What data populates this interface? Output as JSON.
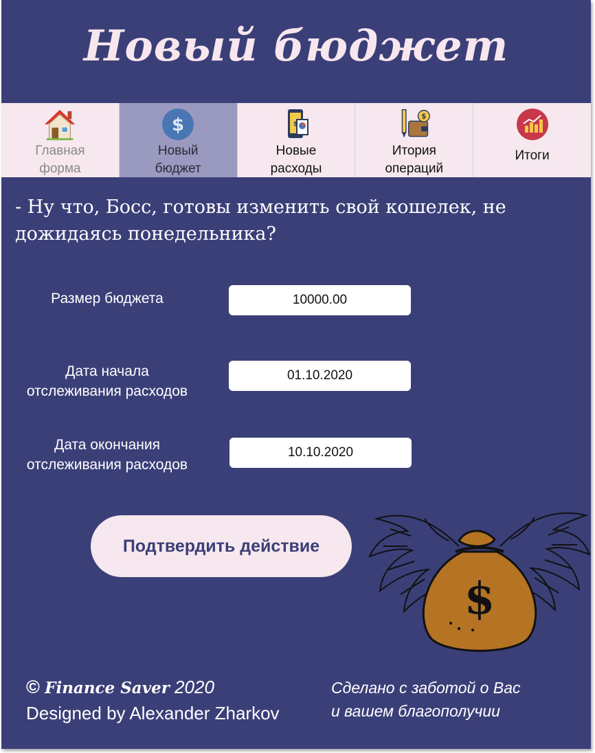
{
  "app": {
    "title": "Новый бюджет"
  },
  "nav": {
    "items": [
      {
        "label": "Главная\nформа",
        "icon": "house-icon"
      },
      {
        "label": "Новый\nбюджет",
        "icon": "dollar-coin-icon"
      },
      {
        "label": "Новые\nрасходы",
        "icon": "phone-payment-icon"
      },
      {
        "label": "Итория\nопераций",
        "icon": "wallet-pencil-icon"
      },
      {
        "label": "Итоги",
        "icon": "chart-up-icon"
      }
    ],
    "active_index": 1
  },
  "prompt": {
    "question": "- Ну что, Босс, готовы изменить свой кошелек, не дожидаясь понедельника?"
  },
  "form": {
    "budget_label": "Размер бюджета",
    "budget_value": "10000.00",
    "start_label": "Дата начала\nотслеживания расходов",
    "start_value": "01.10.2020",
    "end_label": "Дата окончания\nотслеживания расходов",
    "end_value": "10.10.2020",
    "confirm_label": "Подтвердить действие"
  },
  "footer": {
    "copyright_symbol": "©",
    "brand": "Finance Saver",
    "year": "2020",
    "designer": "Designed by Alexander Zharkov",
    "tagline": "Сделано с заботой о Вас\nи вашем благополучии"
  },
  "colors": {
    "background": "#3b3f78",
    "nav_background": "#f6e8ee",
    "nav_active": "#9a9ac0",
    "title_text": "#f7e6ee"
  }
}
